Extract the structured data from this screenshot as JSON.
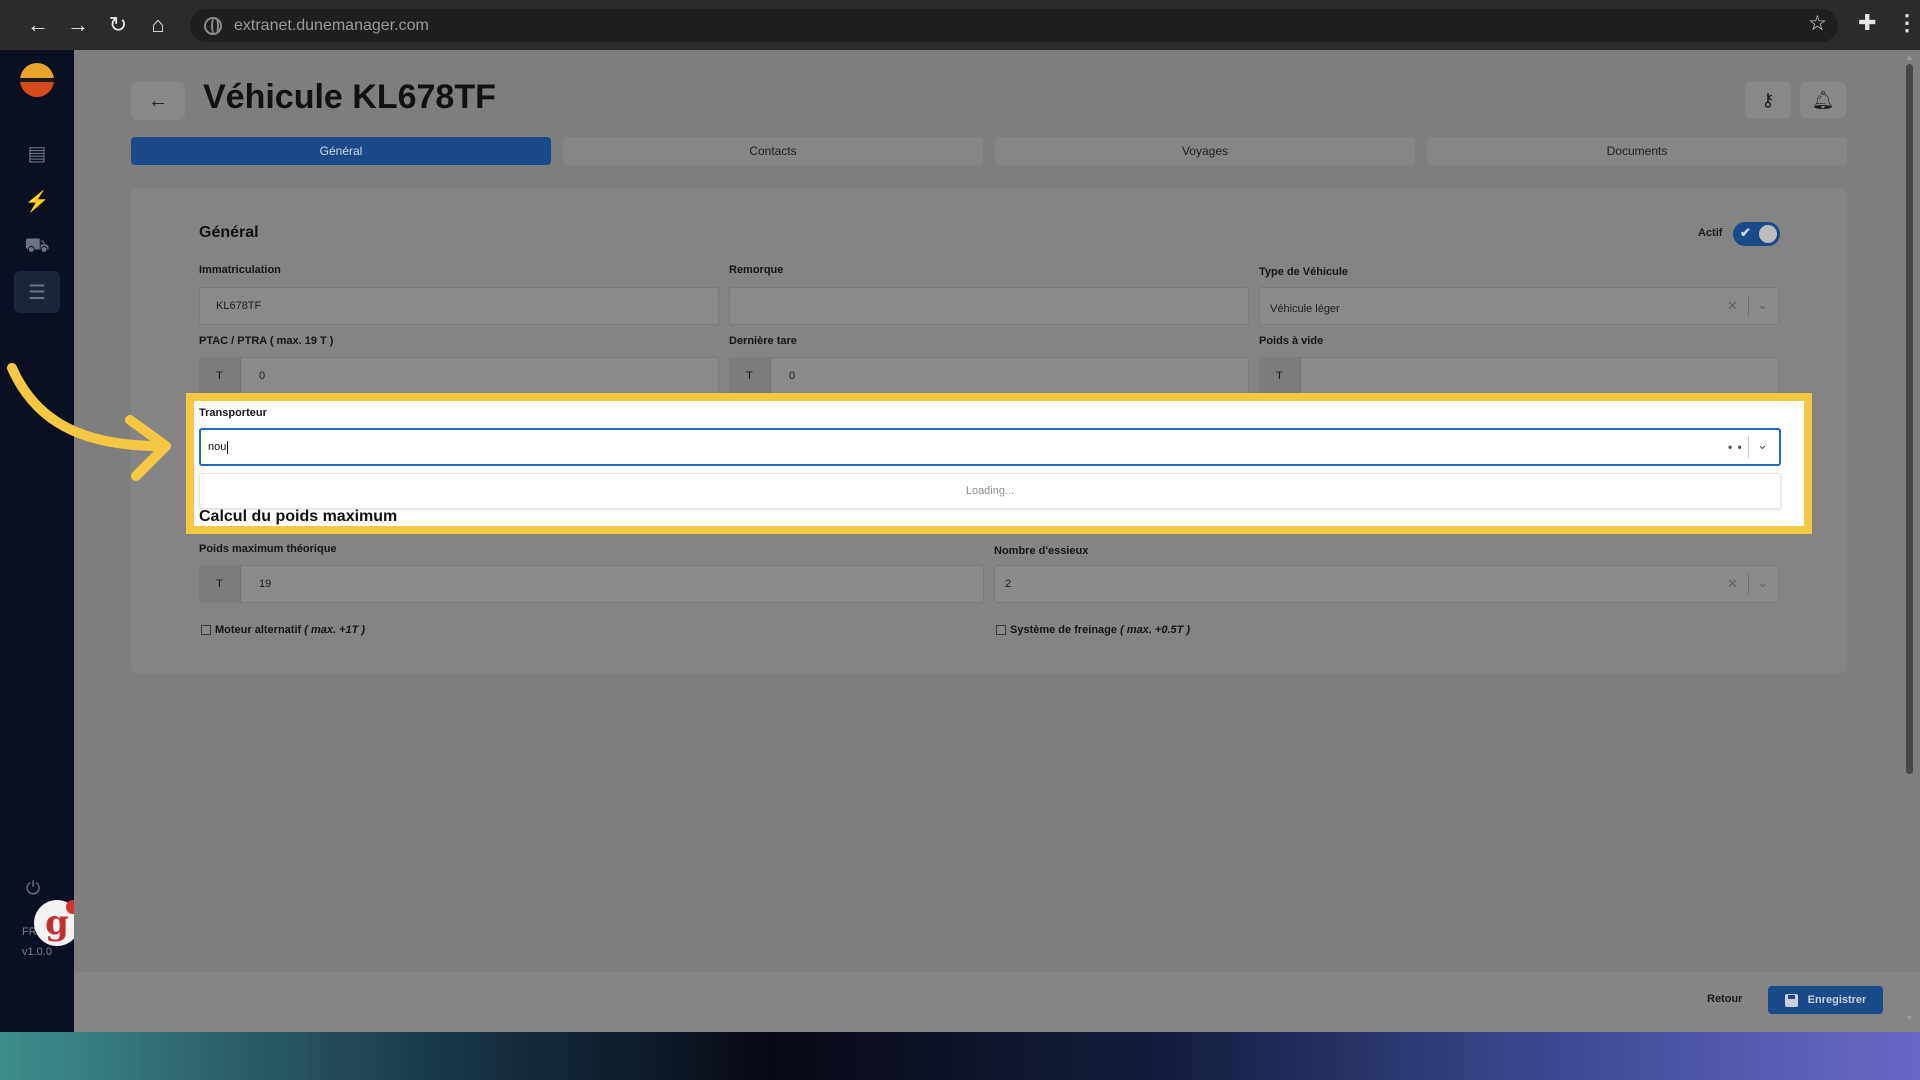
{
  "browser": {
    "url": "extranet.dunemanager.com"
  },
  "sidebar": {
    "lang": "FR",
    "version": "v1.0.0",
    "icons": [
      "document-icon",
      "bolt-icon",
      "truck-icon",
      "list-icon"
    ]
  },
  "header": {
    "title": "Véhicule KL678TF"
  },
  "tabs": [
    {
      "label": "Général",
      "active": true
    },
    {
      "label": "Contacts",
      "active": false
    },
    {
      "label": "Voyages",
      "active": false
    },
    {
      "label": "Documents",
      "active": false
    }
  ],
  "general": {
    "section_title": "Général",
    "actif_label": "Actif",
    "actif": true,
    "immatriculation_label": "Immatriculation",
    "immatriculation_value": "KL678TF",
    "remorque_label": "Remorque",
    "remorque_value": "",
    "type_label": "Type de Véhicule",
    "type_value": "Véhicule léger",
    "ptac_label": "PTAC / PTRA ( max. 19 T )",
    "ptac_unit": "T",
    "ptac_value": "0",
    "tare_label": "Dernière tare",
    "tare_unit": "T",
    "tare_value": "0",
    "vide_label": "Poids à vide",
    "vide_unit": "T",
    "vide_value": ""
  },
  "transporteur": {
    "label": "Transporteur",
    "value": "nou",
    "dropdown_text": "Loading..."
  },
  "calcul": {
    "section_title": "Calcul du poids maximum",
    "poids_label": "Poids maximum théorique",
    "poids_unit": "T",
    "poids_value": "19",
    "essieux_label": "Nombre d'essieux",
    "essieux_value": "2",
    "moteur_label": "Moteur alternatif",
    "moteur_note": "( max. +1T )",
    "frein_label": "Système de freinage",
    "frein_note": "( max. +0.5T )"
  },
  "footer": {
    "retour_label": "Retour",
    "save_label": "Enregistrer"
  },
  "colors": {
    "accent": "#1a4a8a",
    "highlight": "#f5c843",
    "input_focus": "#2266cc"
  }
}
